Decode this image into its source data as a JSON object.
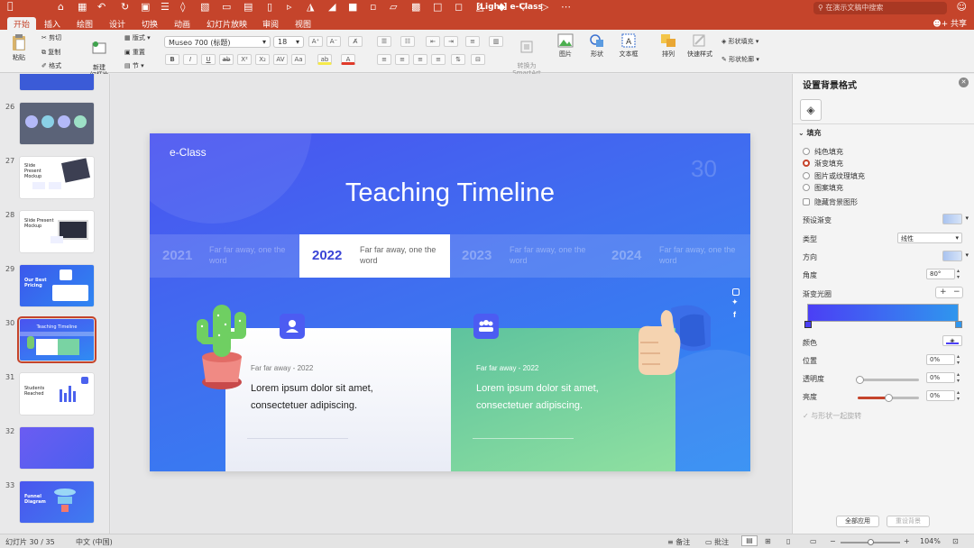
{
  "app": {
    "window_title": "[Light] e-Class",
    "search_placeholder": "在演示文稿中搜索",
    "share_label": "共享"
  },
  "tabs": [
    "开始",
    "插入",
    "绘图",
    "设计",
    "切换",
    "动画",
    "幻灯片放映",
    "审阅",
    "视图"
  ],
  "ribbon": {
    "paste": "粘贴",
    "cut": "剪切",
    "copy": "复制",
    "format": "格式",
    "new_slide": "新建\n幻灯片",
    "layout": "版式",
    "reset": "重置",
    "section": "节",
    "font_name": "Museo 700 (标题)",
    "font_size": "18",
    "convert_smartart": "转换为\nSmartArt",
    "picture": "图片",
    "shape": "形状",
    "textbox": "文本框",
    "arrange": "排列",
    "quick_styles": "快速样式",
    "shape_fill": "形状填充",
    "shape_outline": "形状轮廓"
  },
  "thumbnails": [
    {
      "num": "26",
      "bg": "#5b6378",
      "title": ""
    },
    {
      "num": "27",
      "bg": "#ffffff",
      "title": "Slide Present Mockup"
    },
    {
      "num": "28",
      "bg": "#ffffff",
      "title": "Slide Present Mockup"
    },
    {
      "num": "29",
      "bg": "#4a66ee",
      "title": "Our Best Pricing"
    },
    {
      "num": "30",
      "bg": "#4a60ee",
      "title": "Teaching Timeline"
    },
    {
      "num": "31",
      "bg": "#ffffff",
      "title": "Students Reached"
    },
    {
      "num": "32",
      "bg": "#5a63f0",
      "title": ""
    },
    {
      "num": "33",
      "bg": "#4a55ee",
      "title": "Funnel Diagram"
    }
  ],
  "slide": {
    "brand": "e-Class",
    "page_number": "30",
    "title": "Teaching Timeline",
    "timeline": [
      {
        "year": "2021",
        "text": "Far far away, one the word",
        "active": false
      },
      {
        "year": "2022",
        "text": "Far far away, one the word",
        "active": true
      },
      {
        "year": "2023",
        "text": "Far far away, one the word",
        "active": false
      },
      {
        "year": "2024",
        "text": "Far far away, one the word",
        "active": false
      }
    ],
    "card_left": {
      "kicker": "Far far away - 2022",
      "body": "Lorem ipsum dolor sit amet, consectetuer adipiscing."
    },
    "card_right": {
      "kicker": "Far far away - 2022",
      "body": "Lorem ipsum dolor sit amet, consectetuer adipiscing."
    },
    "social": [
      "instagram-icon",
      "twitter-icon",
      "facebook-icon"
    ]
  },
  "format_panel": {
    "title": "设置背景格式",
    "fill_section": "填充",
    "options": [
      {
        "label": "纯色填充",
        "checked": false
      },
      {
        "label": "渐变填充",
        "checked": true
      },
      {
        "label": "图片或纹理填充",
        "checked": false
      },
      {
        "label": "图案填充",
        "checked": false
      }
    ],
    "hide_bg": "隐藏背景图形",
    "preset_gradient": "预设渐变",
    "type_label": "类型",
    "type_value": "线性",
    "direction": "方向",
    "angle_label": "角度",
    "angle_value": "80°",
    "gradient_stops": "渐变光圈",
    "color": "颜色",
    "position": "位置",
    "position_value": "0%",
    "transparency": "透明度",
    "transparency_value": "0%",
    "brightness": "亮度",
    "brightness_value": "0%",
    "rotate_with_shape": "与形状一起旋转",
    "apply_all": "全部应用",
    "reset_bg": "重设背景",
    "colors": {
      "grad_start": "#4b3ff5",
      "grad_end": "#2f96ee",
      "accent": "#c5442b"
    }
  },
  "status": {
    "slide_info": "幻灯片 30 / 35",
    "language": "中文 (中国)",
    "notes": "备注",
    "comments": "批注",
    "zoom": "104%"
  }
}
